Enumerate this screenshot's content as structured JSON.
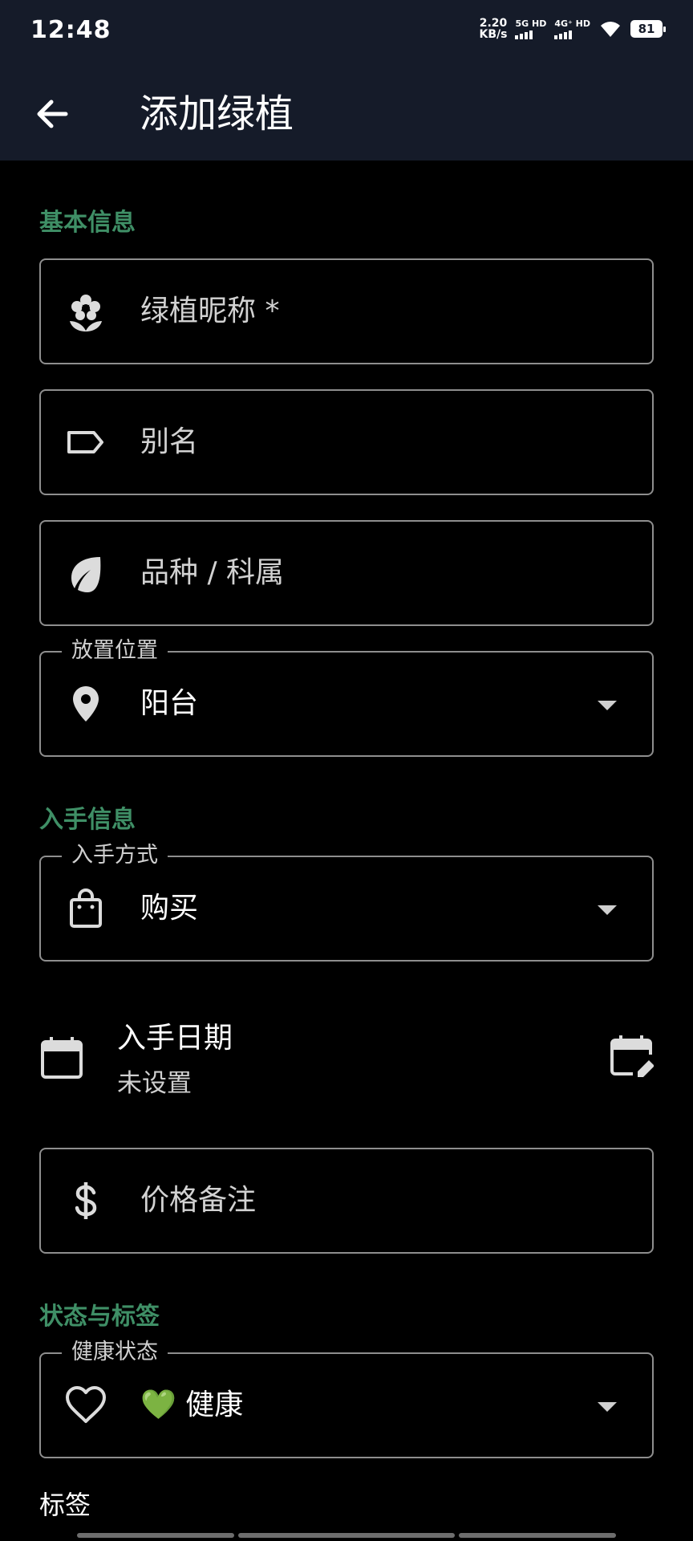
{
  "status_bar": {
    "time": "12:48",
    "net_speed_value": "2.20",
    "net_speed_unit": "KB/s",
    "sim1": "5G HD",
    "sim2": "4G⁺ HD",
    "battery": "81"
  },
  "app_bar": {
    "back_icon": "arrow-left-icon",
    "title": "添加绿植"
  },
  "sections": {
    "basic": "基本信息",
    "acquire": "入手信息",
    "status": "状态与标签"
  },
  "fields": {
    "nickname": {
      "placeholder": "绿植昵称 *",
      "icon": "flower-icon"
    },
    "alias": {
      "placeholder": "别名",
      "icon": "label-icon"
    },
    "species": {
      "placeholder": "品种 / 科属",
      "icon": "leaf-icon"
    },
    "location": {
      "legend": "放置位置",
      "value": "阳台",
      "icon": "location-pin-icon"
    },
    "acquire_method": {
      "legend": "入手方式",
      "value": "购买",
      "icon": "shopping-bag-icon"
    },
    "price": {
      "placeholder": "价格备注",
      "icon": "dollar-icon"
    },
    "health": {
      "legend": "健康状态",
      "value": "💚 健康",
      "icon": "heart-icon"
    }
  },
  "acquire_date": {
    "label": "入手日期",
    "value": "未设置",
    "icon": "calendar-icon",
    "edit_icon": "calendar-edit-icon"
  },
  "tags": {
    "label": "标签"
  },
  "colors": {
    "app_bar_bg": "#151b29",
    "section_accent": "#3f8f66",
    "background": "#000000",
    "outline": "#8e8e8e"
  }
}
